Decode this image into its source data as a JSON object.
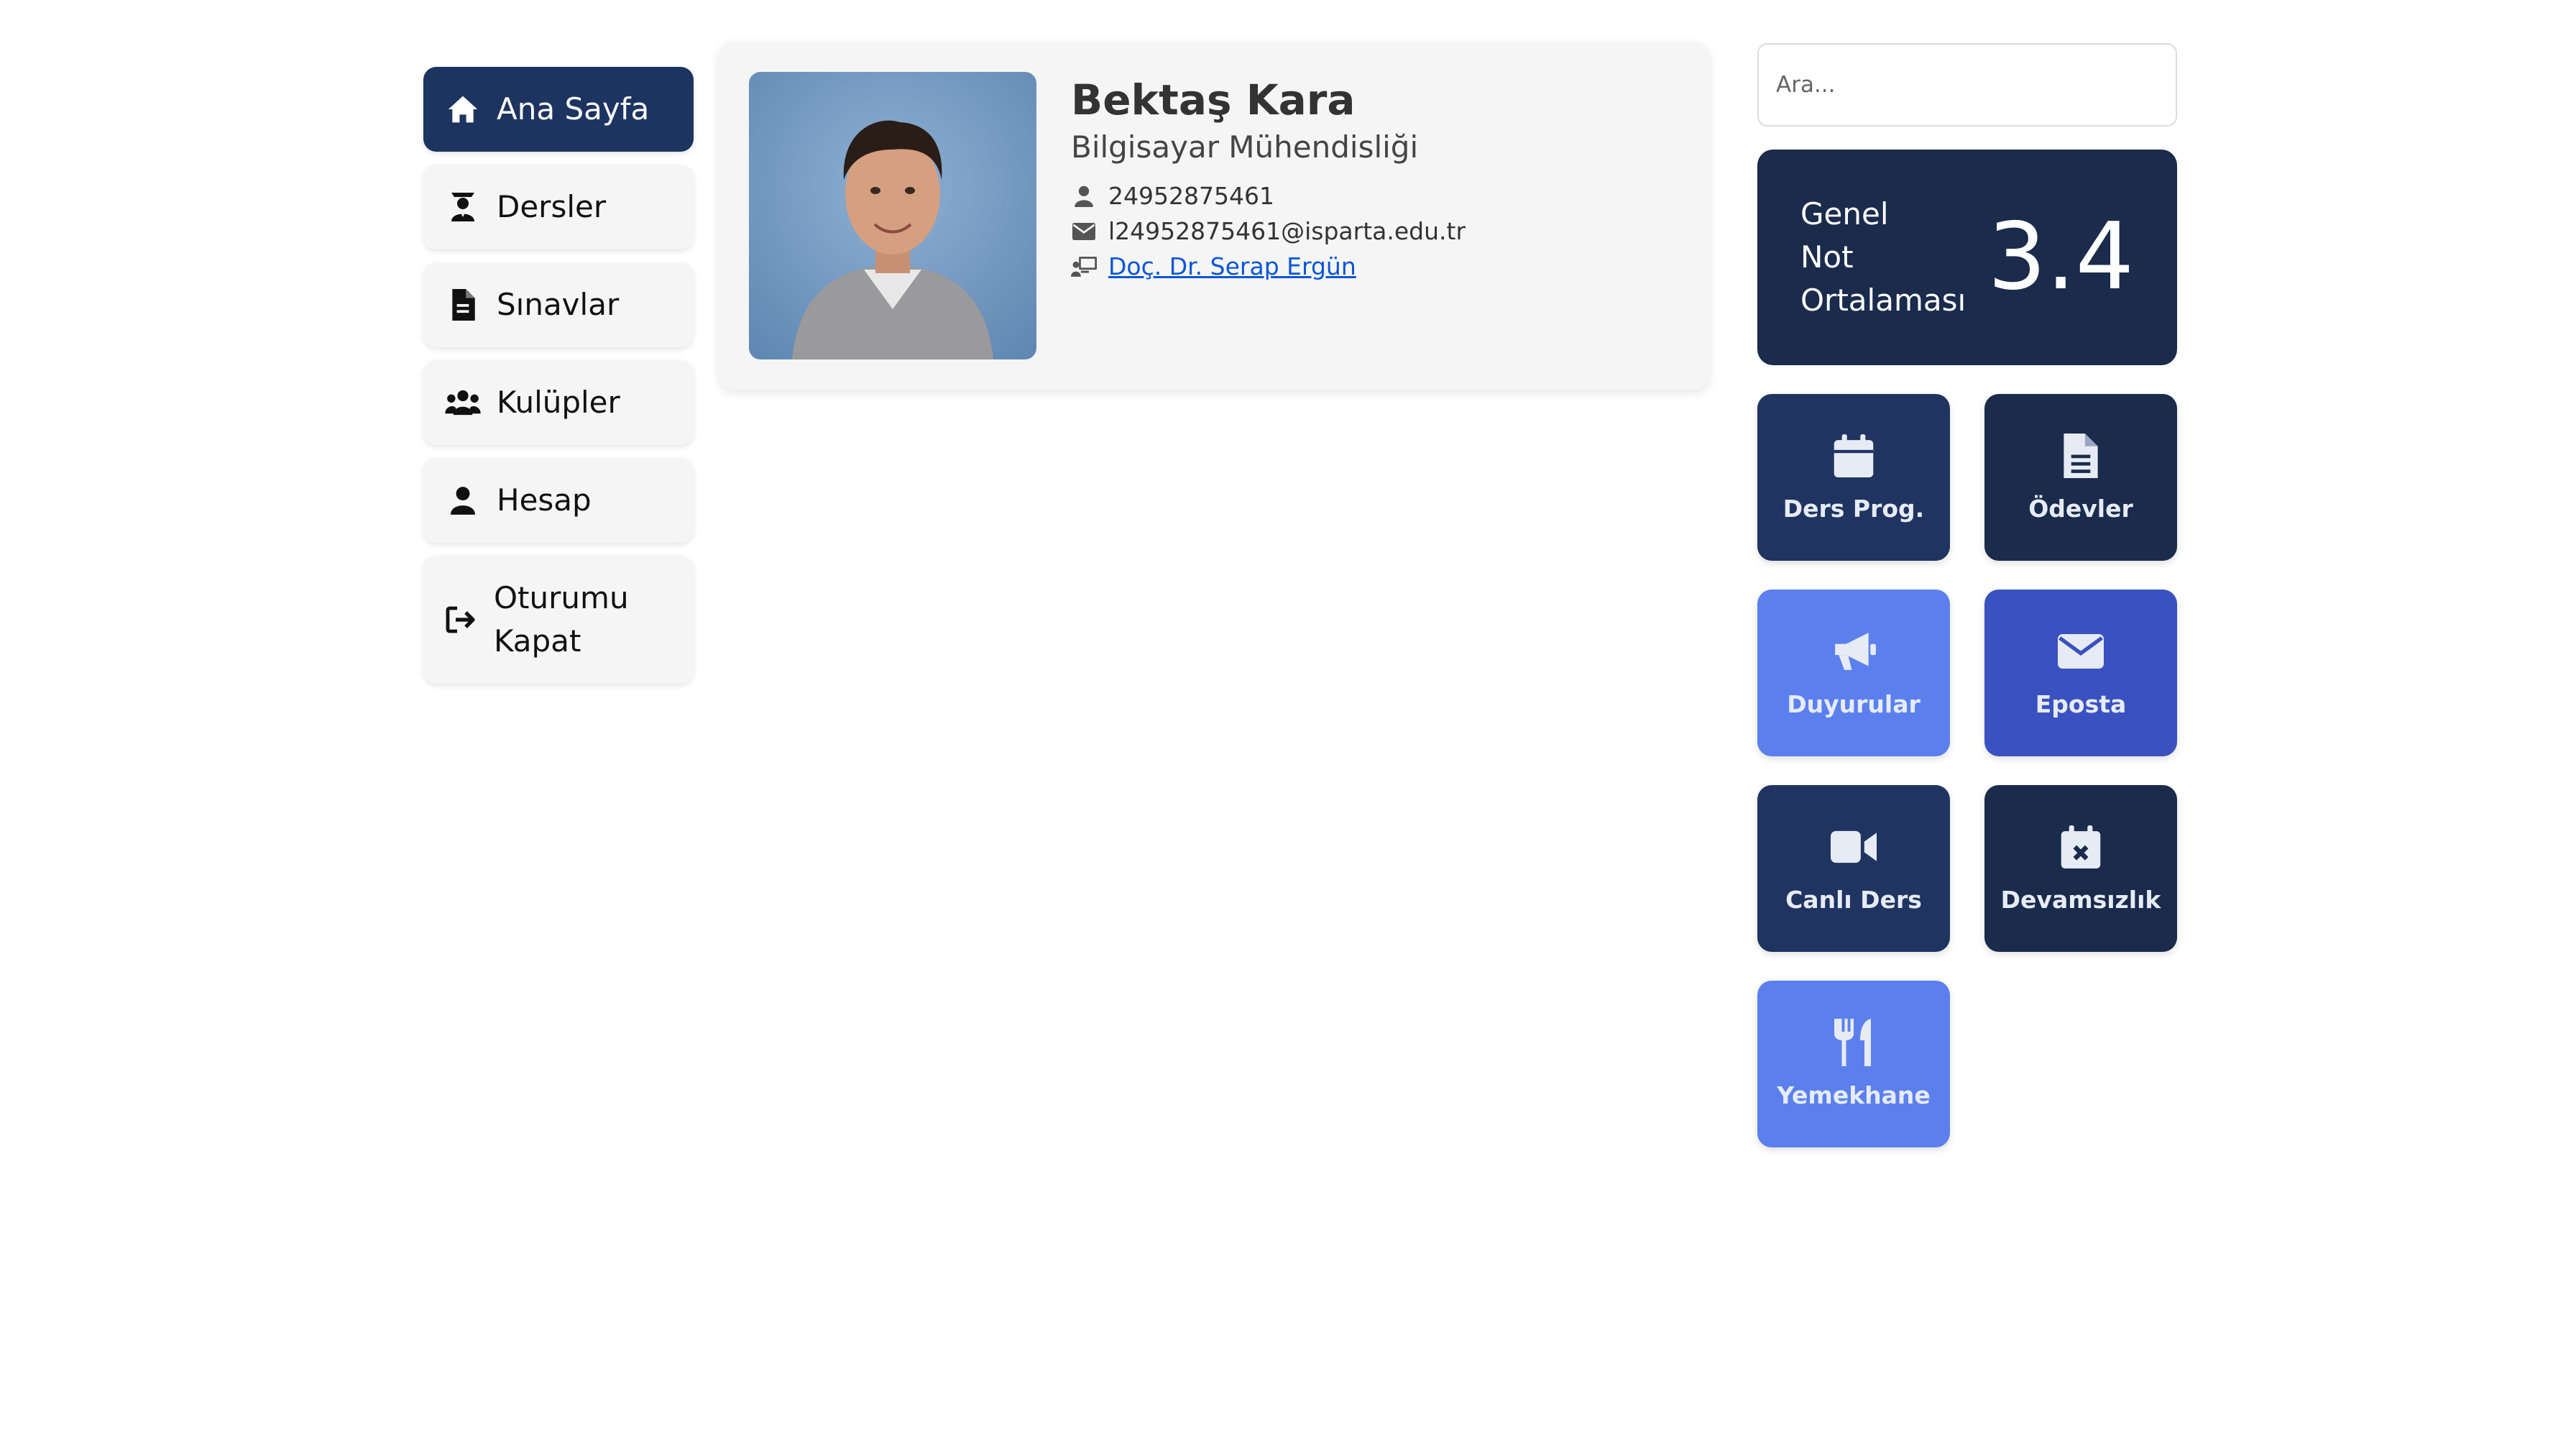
{
  "sidebar": {
    "items": [
      {
        "label": "Ana Sayfa",
        "icon": "home-icon",
        "active": true
      },
      {
        "label": "Dersler",
        "icon": "teacher-icon"
      },
      {
        "label": "Sınavlar",
        "icon": "document-icon"
      },
      {
        "label": "Kulüpler",
        "icon": "users-icon"
      },
      {
        "label": "Hesap",
        "icon": "user-icon"
      },
      {
        "label": "Oturumu\nKapat",
        "icon": "logout-icon"
      }
    ]
  },
  "profile": {
    "name": "Bektaş Kara",
    "department": "Bilgisayar Mühendisliği",
    "student_id": "24952875461",
    "email": "l24952875461@isparta.edu.tr",
    "advisor": "Doç. Dr. Serap Ergün"
  },
  "search": {
    "placeholder": "Ara..."
  },
  "gpa": {
    "label": "Genel\nNot\nOrtalaması",
    "value": "3.4"
  },
  "tiles": [
    {
      "label": "Ders Prog.",
      "icon": "calendar-icon",
      "color": "#1f3460"
    },
    {
      "label": "Ödevler",
      "icon": "file-icon",
      "color": "#1a2b4c"
    },
    {
      "label": "Duyurular",
      "icon": "megaphone-icon",
      "color": "#5b80ee"
    },
    {
      "label": "Eposta",
      "icon": "envelope-icon",
      "color": "#3a52c0"
    },
    {
      "label": "Canlı Ders",
      "icon": "video-icon",
      "color": "#1f3460"
    },
    {
      "label": "Devamsızlık",
      "icon": "calendar-x-icon",
      "color": "#1a2b4c"
    },
    {
      "label": "Yemekhane",
      "icon": "utensils-icon",
      "color": "#5b80ee"
    }
  ]
}
